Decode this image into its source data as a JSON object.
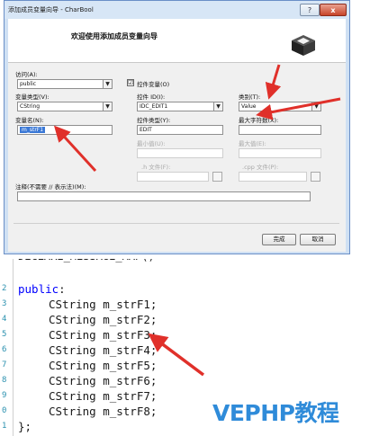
{
  "dialog": {
    "title": "添加成员变量向导 - CharBool",
    "help_glyph": "?",
    "close_glyph": "x",
    "header_title": "欢迎使用添加成员变量向导",
    "access": {
      "label": "访问(A):",
      "value": "public"
    },
    "control_var": {
      "label": "控件变量(O)",
      "checked": "☑"
    },
    "var_type": {
      "label": "变量类型(V):",
      "value": "CString"
    },
    "control_id": {
      "label": "控件 ID(I):",
      "value": "IDC_EDIT1"
    },
    "category": {
      "label": "类别(T):",
      "value": "Value"
    },
    "var_name": {
      "label": "变量名(N):",
      "value": "m_strF1"
    },
    "control_type": {
      "label": "控件类型(Y):",
      "value": "EDIT"
    },
    "max_chars": {
      "label": "最大字符数(X):",
      "value": ""
    },
    "min_value": {
      "label": "最小值(U):",
      "value": ""
    },
    "max_value": {
      "label": "最大值(E):",
      "value": ""
    },
    "h_file": {
      "label": ".h 文件(F):",
      "value": ""
    },
    "cpp_file": {
      "label": ".cpp 文件(P):",
      "value": ""
    },
    "comment": {
      "label": "注释(不需要 // 表示法)(M):",
      "value": ""
    },
    "finish_label": "完成",
    "cancel_label": "取消",
    "dropdown_glyph": "▼"
  },
  "code": {
    "line_numbers": [
      "2",
      "3",
      "4",
      "5",
      "6",
      "7",
      "8",
      "9",
      "0",
      "1"
    ],
    "access_keyword": "public",
    "access_colon": ":",
    "members": [
      "CString m_strF1;",
      "CString m_strF2;",
      "CString m_strF3;",
      "CString m_strF4;",
      "CString m_strF5;",
      "CString m_strF6;",
      "CString m_strF7;",
      "CString m_strF8;"
    ],
    "closing": "};"
  },
  "watermark": "VEPHP教程",
  "colors": {
    "arrow": "#e0302a",
    "watermark": "#2f8bd9",
    "keyword": "#0000ff",
    "selection": "#3a78d6"
  }
}
